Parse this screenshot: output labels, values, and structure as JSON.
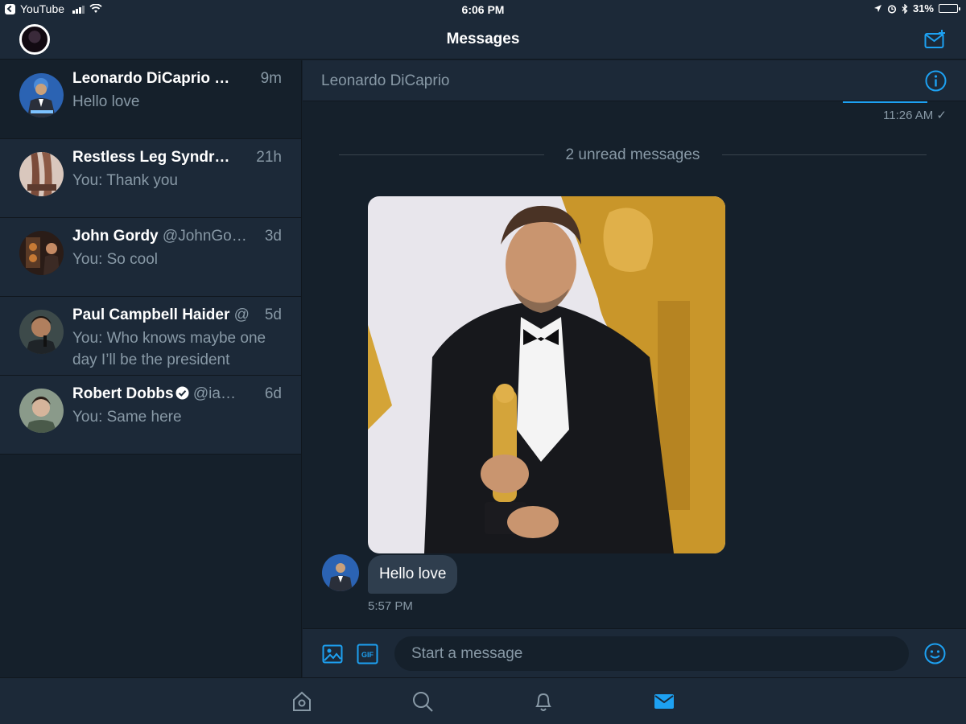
{
  "status_bar": {
    "back_app": "YouTube",
    "time": "6:06 PM",
    "battery": "31%",
    "battery_level": 0.31
  },
  "nav": {
    "title": "Messages"
  },
  "conversations": [
    {
      "name": "Leonardo DiCaprio …",
      "handle": "",
      "time": "9m",
      "snippet": "Hello love",
      "active": true
    },
    {
      "name": "Restless Leg Syndr…",
      "handle": "",
      "time": "21h",
      "snippet": "You: Thank you"
    },
    {
      "name": "John Gordy",
      "handle": "@JohnGo…",
      "time": "3d",
      "snippet": "You: So cool"
    },
    {
      "name": "Paul Campbell Haider",
      "handle": "@",
      "time": "5d",
      "snippet": "You: Who knows maybe one day I’ll be the president"
    },
    {
      "name": "Robert Dobbs",
      "handle": "@ia…",
      "time": "6d",
      "snippet": "You: Same here",
      "verified": true
    }
  ],
  "chat": {
    "header_name": "Leonardo DiCaprio",
    "previous_time": "11:26 AM ✓",
    "unread_label": "2 unread messages",
    "message_text": "Hello love",
    "message_time": "5:57 PM"
  },
  "composer": {
    "placeholder": "Start a message"
  },
  "colors": {
    "accent": "#1da1f2",
    "background": "#15202b",
    "panel": "#1c2938",
    "muted_text": "#8899a6"
  },
  "icons": {
    "compose": "compose-message-icon",
    "info": "info-icon",
    "image": "image-icon",
    "gif": "gif-icon",
    "emoji": "emoji-icon",
    "home": "home-icon",
    "search": "search-icon",
    "notifications": "bell-icon",
    "messages": "envelope-icon"
  }
}
